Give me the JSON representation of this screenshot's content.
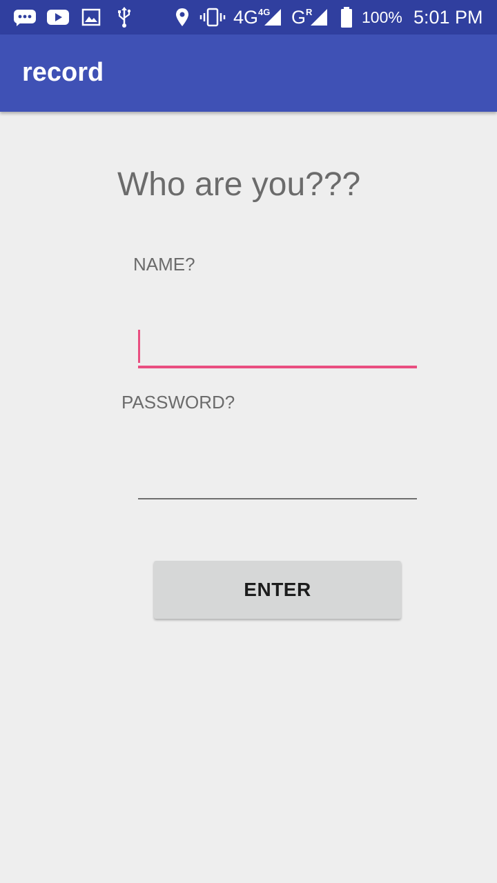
{
  "status_bar": {
    "icons_left": [
      "messages-icon",
      "youtube-icon",
      "gallery-icon",
      "usb-icon"
    ],
    "icons_right": [
      "location-icon",
      "vibrate-icon",
      "signal-4g-icon",
      "signal-g-icon",
      "battery-icon"
    ],
    "network_1": "4G",
    "network_1_sup": "4G",
    "network_2": "G",
    "network_2_sup": "R",
    "battery": "100%",
    "time": "5:01 PM"
  },
  "app_bar": {
    "title": "record"
  },
  "form": {
    "heading": "Who are you???",
    "name_label": "NAME?",
    "name_value": "",
    "password_label": "PASSWORD?",
    "password_value": "",
    "enter_label": "ENTER"
  },
  "colors": {
    "status_bar": "#303f9f",
    "app_bar": "#3f51b5",
    "accent": "#e94e80",
    "background": "#eeeeee",
    "button": "#d6d7d7"
  }
}
